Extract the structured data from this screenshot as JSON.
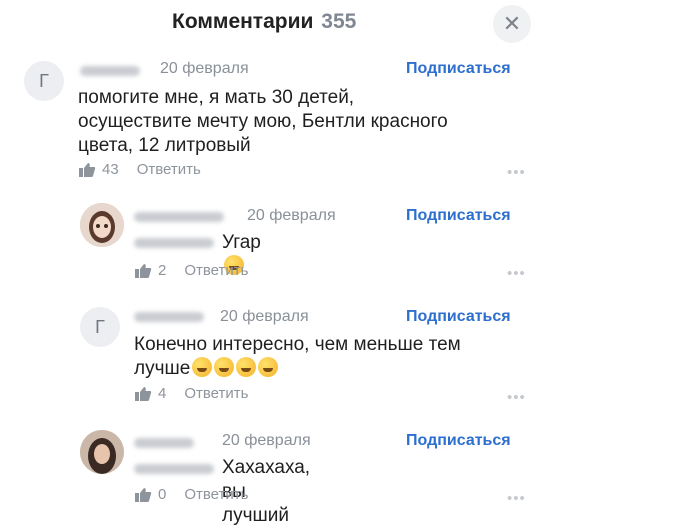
{
  "header": {
    "title": "Комментарии",
    "count": "355",
    "close_icon": "close-icon"
  },
  "comments": [
    {
      "avatar_letter": "Г",
      "date": "20 февраля",
      "subscribe_label": "Подписаться",
      "text_lines": [
        "помогите мне, я мать 30 детей,",
        "осуществите мечту мою, Бентли красного",
        "цвета, 12 литровый"
      ],
      "likes": "43",
      "reply_label": "Ответить",
      "more": "•••"
    },
    {
      "date": "20 февраля",
      "subscribe_label": "Подписаться",
      "text": "Угар",
      "likes": "2",
      "reply_label": "Ответить",
      "more": "•••"
    },
    {
      "avatar_letter": "Г",
      "date": "20 февраля",
      "subscribe_label": "Подписаться",
      "text_lines": [
        "Конечно интересно, чем меньше тем",
        "лучше"
      ],
      "likes": "4",
      "reply_label": "Ответить",
      "more": "•••"
    },
    {
      "date": "20 февраля",
      "subscribe_label": "Подписаться",
      "text": "Хахахаха, вы лучший",
      "likes": "0",
      "reply_label": "Ответить",
      "more": "•••"
    }
  ]
}
